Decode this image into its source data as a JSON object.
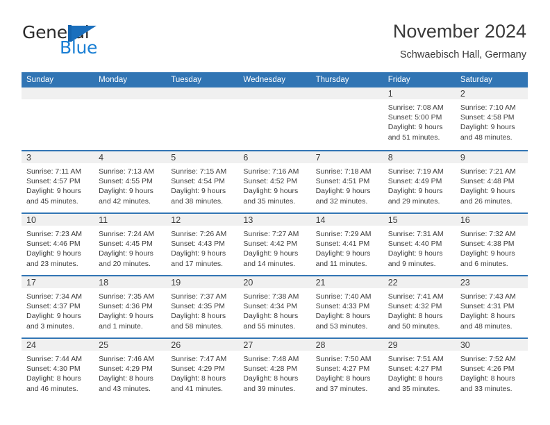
{
  "brand": {
    "name_top": "General",
    "name_bottom": "Blue",
    "logo_icon": "blue-triangle-flag-icon",
    "color_dark": "#2b2b2b",
    "color_blue": "#1a7fd4"
  },
  "header": {
    "title": "November 2024",
    "subtitle": "Schwaebisch Hall, Germany"
  },
  "calendar": {
    "accent_color": "#3175b4",
    "band_color": "#f0f0f0",
    "weekdays": [
      "Sunday",
      "Monday",
      "Tuesday",
      "Wednesday",
      "Thursday",
      "Friday",
      "Saturday"
    ],
    "weeks": [
      [
        {
          "day": "",
          "empty": true
        },
        {
          "day": "",
          "empty": true
        },
        {
          "day": "",
          "empty": true
        },
        {
          "day": "",
          "empty": true
        },
        {
          "day": "",
          "empty": true
        },
        {
          "day": "1",
          "sunrise": "Sunrise: 7:08 AM",
          "sunset": "Sunset: 5:00 PM",
          "daylight": "Daylight: 9 hours and 51 minutes."
        },
        {
          "day": "2",
          "sunrise": "Sunrise: 7:10 AM",
          "sunset": "Sunset: 4:58 PM",
          "daylight": "Daylight: 9 hours and 48 minutes."
        }
      ],
      [
        {
          "day": "3",
          "sunrise": "Sunrise: 7:11 AM",
          "sunset": "Sunset: 4:57 PM",
          "daylight": "Daylight: 9 hours and 45 minutes."
        },
        {
          "day": "4",
          "sunrise": "Sunrise: 7:13 AM",
          "sunset": "Sunset: 4:55 PM",
          "daylight": "Daylight: 9 hours and 42 minutes."
        },
        {
          "day": "5",
          "sunrise": "Sunrise: 7:15 AM",
          "sunset": "Sunset: 4:54 PM",
          "daylight": "Daylight: 9 hours and 38 minutes."
        },
        {
          "day": "6",
          "sunrise": "Sunrise: 7:16 AM",
          "sunset": "Sunset: 4:52 PM",
          "daylight": "Daylight: 9 hours and 35 minutes."
        },
        {
          "day": "7",
          "sunrise": "Sunrise: 7:18 AM",
          "sunset": "Sunset: 4:51 PM",
          "daylight": "Daylight: 9 hours and 32 minutes."
        },
        {
          "day": "8",
          "sunrise": "Sunrise: 7:19 AM",
          "sunset": "Sunset: 4:49 PM",
          "daylight": "Daylight: 9 hours and 29 minutes."
        },
        {
          "day": "9",
          "sunrise": "Sunrise: 7:21 AM",
          "sunset": "Sunset: 4:48 PM",
          "daylight": "Daylight: 9 hours and 26 minutes."
        }
      ],
      [
        {
          "day": "10",
          "sunrise": "Sunrise: 7:23 AM",
          "sunset": "Sunset: 4:46 PM",
          "daylight": "Daylight: 9 hours and 23 minutes."
        },
        {
          "day": "11",
          "sunrise": "Sunrise: 7:24 AM",
          "sunset": "Sunset: 4:45 PM",
          "daylight": "Daylight: 9 hours and 20 minutes."
        },
        {
          "day": "12",
          "sunrise": "Sunrise: 7:26 AM",
          "sunset": "Sunset: 4:43 PM",
          "daylight": "Daylight: 9 hours and 17 minutes."
        },
        {
          "day": "13",
          "sunrise": "Sunrise: 7:27 AM",
          "sunset": "Sunset: 4:42 PM",
          "daylight": "Daylight: 9 hours and 14 minutes."
        },
        {
          "day": "14",
          "sunrise": "Sunrise: 7:29 AM",
          "sunset": "Sunset: 4:41 PM",
          "daylight": "Daylight: 9 hours and 11 minutes."
        },
        {
          "day": "15",
          "sunrise": "Sunrise: 7:31 AM",
          "sunset": "Sunset: 4:40 PM",
          "daylight": "Daylight: 9 hours and 9 minutes."
        },
        {
          "day": "16",
          "sunrise": "Sunrise: 7:32 AM",
          "sunset": "Sunset: 4:38 PM",
          "daylight": "Daylight: 9 hours and 6 minutes."
        }
      ],
      [
        {
          "day": "17",
          "sunrise": "Sunrise: 7:34 AM",
          "sunset": "Sunset: 4:37 PM",
          "daylight": "Daylight: 9 hours and 3 minutes."
        },
        {
          "day": "18",
          "sunrise": "Sunrise: 7:35 AM",
          "sunset": "Sunset: 4:36 PM",
          "daylight": "Daylight: 9 hours and 1 minute."
        },
        {
          "day": "19",
          "sunrise": "Sunrise: 7:37 AM",
          "sunset": "Sunset: 4:35 PM",
          "daylight": "Daylight: 8 hours and 58 minutes."
        },
        {
          "day": "20",
          "sunrise": "Sunrise: 7:38 AM",
          "sunset": "Sunset: 4:34 PM",
          "daylight": "Daylight: 8 hours and 55 minutes."
        },
        {
          "day": "21",
          "sunrise": "Sunrise: 7:40 AM",
          "sunset": "Sunset: 4:33 PM",
          "daylight": "Daylight: 8 hours and 53 minutes."
        },
        {
          "day": "22",
          "sunrise": "Sunrise: 7:41 AM",
          "sunset": "Sunset: 4:32 PM",
          "daylight": "Daylight: 8 hours and 50 minutes."
        },
        {
          "day": "23",
          "sunrise": "Sunrise: 7:43 AM",
          "sunset": "Sunset: 4:31 PM",
          "daylight": "Daylight: 8 hours and 48 minutes."
        }
      ],
      [
        {
          "day": "24",
          "sunrise": "Sunrise: 7:44 AM",
          "sunset": "Sunset: 4:30 PM",
          "daylight": "Daylight: 8 hours and 46 minutes."
        },
        {
          "day": "25",
          "sunrise": "Sunrise: 7:46 AM",
          "sunset": "Sunset: 4:29 PM",
          "daylight": "Daylight: 8 hours and 43 minutes."
        },
        {
          "day": "26",
          "sunrise": "Sunrise: 7:47 AM",
          "sunset": "Sunset: 4:29 PM",
          "daylight": "Daylight: 8 hours and 41 minutes."
        },
        {
          "day": "27",
          "sunrise": "Sunrise: 7:48 AM",
          "sunset": "Sunset: 4:28 PM",
          "daylight": "Daylight: 8 hours and 39 minutes."
        },
        {
          "day": "28",
          "sunrise": "Sunrise: 7:50 AM",
          "sunset": "Sunset: 4:27 PM",
          "daylight": "Daylight: 8 hours and 37 minutes."
        },
        {
          "day": "29",
          "sunrise": "Sunrise: 7:51 AM",
          "sunset": "Sunset: 4:27 PM",
          "daylight": "Daylight: 8 hours and 35 minutes."
        },
        {
          "day": "30",
          "sunrise": "Sunrise: 7:52 AM",
          "sunset": "Sunset: 4:26 PM",
          "daylight": "Daylight: 8 hours and 33 minutes."
        }
      ]
    ]
  }
}
